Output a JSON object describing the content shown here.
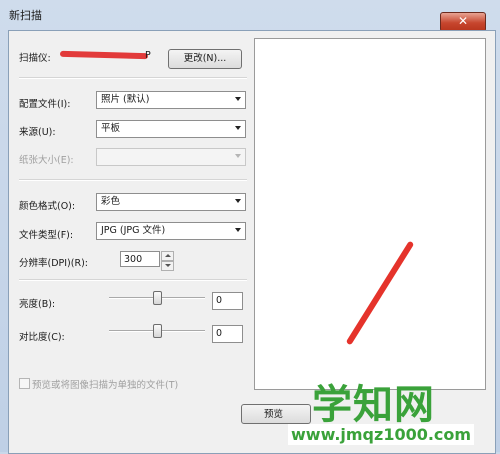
{
  "window": {
    "title": "新扫描",
    "close_glyph": "✕"
  },
  "scanner": {
    "label": "扫描仪:",
    "name_suffix": "P",
    "change_button": "更改(N)..."
  },
  "profile": {
    "label": "配置文件(I):",
    "value": "照片 (默认)"
  },
  "source": {
    "label": "来源(U):",
    "value": "平板"
  },
  "paper_size": {
    "label": "纸张大小(E):",
    "value": ""
  },
  "color_format": {
    "label": "颜色格式(O):",
    "value": "彩色"
  },
  "file_type": {
    "label": "文件类型(F):",
    "value": "JPG (JPG 文件)"
  },
  "resolution": {
    "label": "分辨率(DPI)(R):",
    "value": "300"
  },
  "brightness": {
    "label": "亮度(B):",
    "value": "0",
    "level": 0
  },
  "contrast": {
    "label": "对比度(C):",
    "value": "0",
    "level": 0
  },
  "separate_files": {
    "label": "预览或将图像扫描为单独的文件(T)",
    "checked": false
  },
  "preview": {
    "button": "预览"
  },
  "watermark": {
    "main": "学知网",
    "url": "www.jmqz1000.com"
  },
  "colors": {
    "redaction": "#e23a3a",
    "watermark": "#3aa23a"
  }
}
